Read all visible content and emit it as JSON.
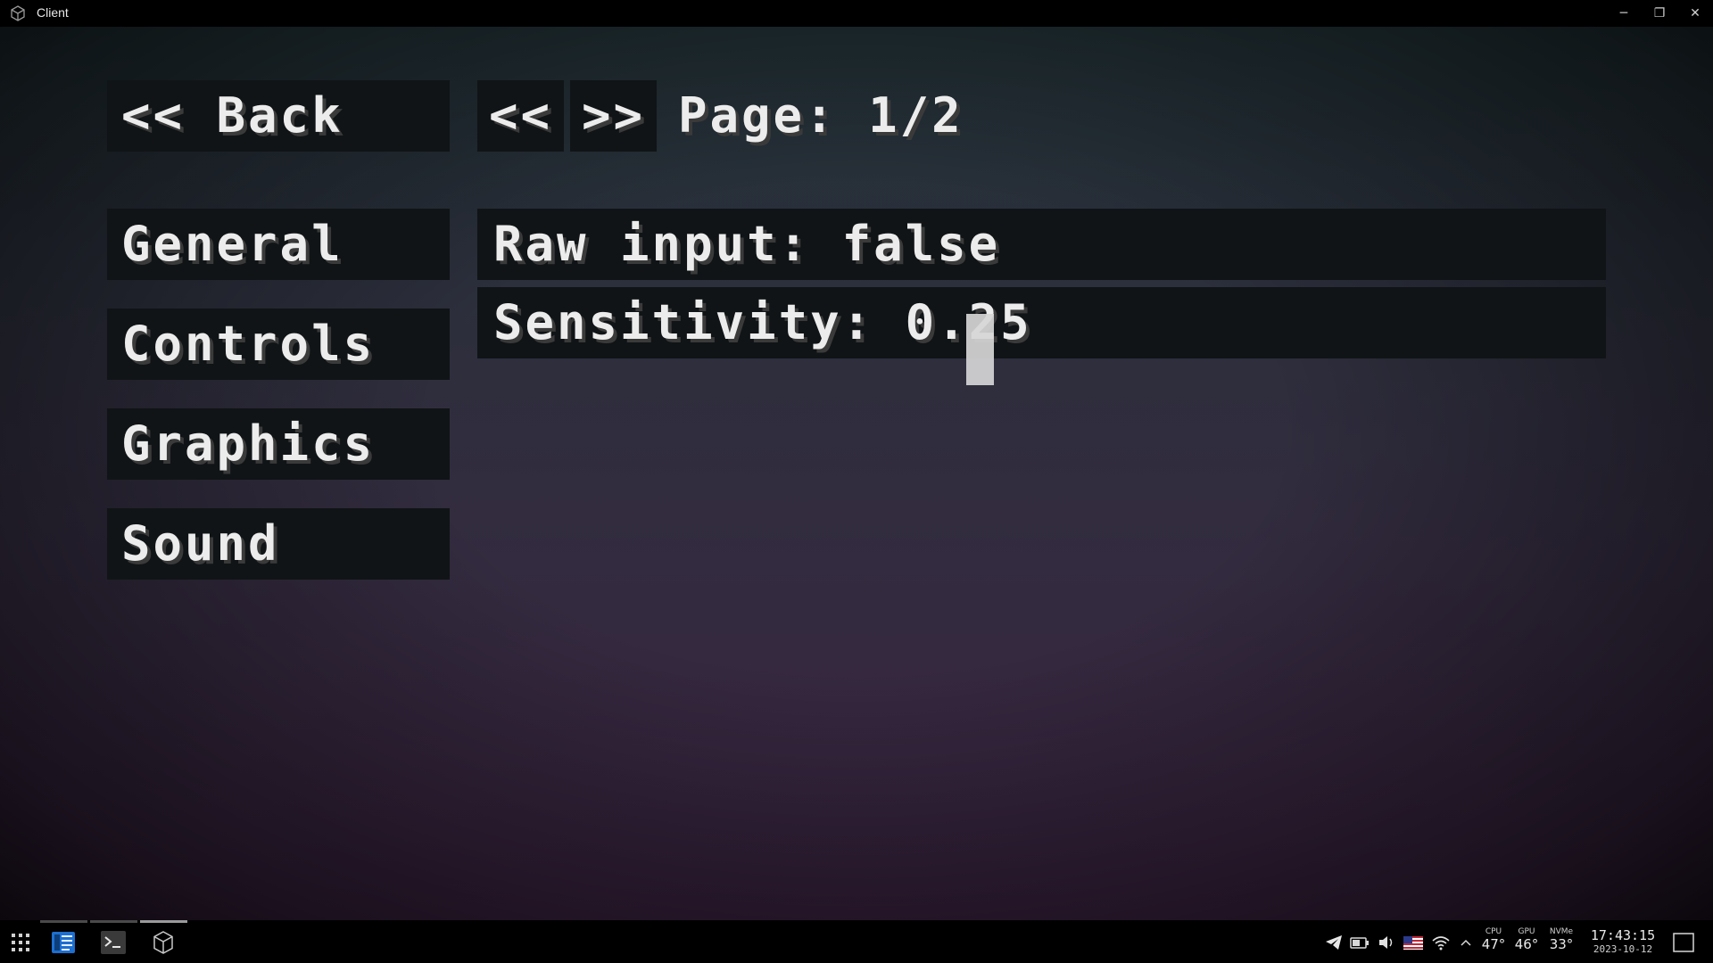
{
  "window": {
    "title": "Client"
  },
  "window_controls": {
    "minimize": "─",
    "maximize": "❐",
    "close": "✕"
  },
  "menu": {
    "back_label": "<< Back",
    "prev_label": "<<",
    "next_label": ">>",
    "page_label": "Page: 1/2",
    "categories": [
      "General",
      "Controls",
      "Graphics",
      "Sound"
    ]
  },
  "settings": [
    {
      "label": "Raw input: false"
    },
    {
      "label": "Sensitivity: 0.25"
    }
  ],
  "taskbar": {
    "sensors": [
      {
        "label": "CPU",
        "value": "47°"
      },
      {
        "label": "GPU",
        "value": "46°"
      },
      {
        "label": "NVMe",
        "value": "33°"
      }
    ],
    "time": "17:43:15",
    "date": "2023-10-12"
  }
}
